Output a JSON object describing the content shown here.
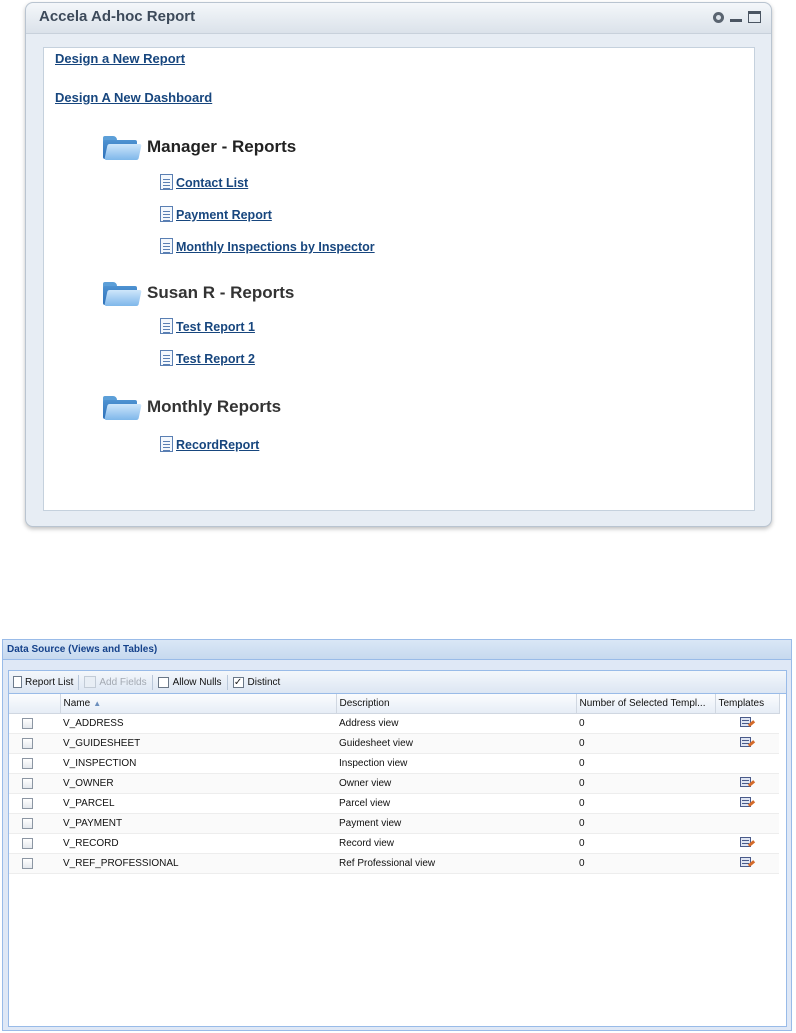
{
  "portlet": {
    "title": "Accela Ad-hoc Report",
    "header_icons": [
      "gear-icon",
      "minimize-icon",
      "maximize-icon"
    ],
    "links": {
      "design_report": "Design a New Report",
      "design_dashboard": "Design A New Dashboard"
    },
    "folders": [
      {
        "title": "Manager - Reports",
        "reports": [
          "Contact List",
          "Payment Report",
          "Monthly Inspections by Inspector"
        ]
      },
      {
        "title": "Susan R - Reports",
        "reports": [
          "Test Report 1",
          "Test Report 2"
        ]
      },
      {
        "title": "Monthly Reports",
        "reports": [
          "RecordReport"
        ]
      }
    ]
  },
  "data_source": {
    "title": "Data Source (Views and Tables)",
    "toolbar": {
      "report_list": "Report List",
      "add_fields": "Add Fields",
      "allow_nulls": "Allow Nulls",
      "allow_nulls_checked": false,
      "distinct": "Distinct",
      "distinct_checked": true
    },
    "columns": [
      "Name",
      "Description",
      "Number of Selected Templ...",
      "Templates"
    ],
    "rows": [
      {
        "name": "V_ADDRESS",
        "description": "Address view",
        "count": "0",
        "has_template": true
      },
      {
        "name": "V_GUIDESHEET",
        "description": "Guidesheet view",
        "count": "0",
        "has_template": true
      },
      {
        "name": "V_INSPECTION",
        "description": "Inspection view",
        "count": "0",
        "has_template": false
      },
      {
        "name": "V_OWNER",
        "description": "Owner view",
        "count": "0",
        "has_template": true
      },
      {
        "name": "V_PARCEL",
        "description": "Parcel view",
        "count": "0",
        "has_template": true
      },
      {
        "name": "V_PAYMENT",
        "description": "Payment view",
        "count": "0",
        "has_template": false
      },
      {
        "name": "V_RECORD",
        "description": "Record view",
        "count": "0",
        "has_template": true
      },
      {
        "name": "V_REF_PROFESSIONAL",
        "description": "Ref Professional view",
        "count": "0",
        "has_template": true
      }
    ]
  }
}
